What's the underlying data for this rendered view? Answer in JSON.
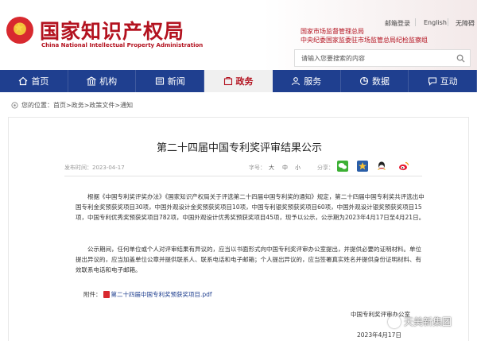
{
  "header": {
    "site_title": "国家知识产权局",
    "site_subtitle": "China National Intellectual Property Administration",
    "org_line1": "国家市场监督管理总局",
    "org_line2": "中央纪委国家监委驻市场监管总局纪检监察组",
    "links": {
      "mail": "邮箱登录",
      "english": "English",
      "accessible": "无障碍"
    },
    "search_placeholder": "请输入您要搜索的内容"
  },
  "nav": {
    "items": [
      {
        "label": "首页",
        "icon": "home-icon"
      },
      {
        "label": "机构",
        "icon": "building-icon"
      },
      {
        "label": "新闻",
        "icon": "news-icon"
      },
      {
        "label": "政务",
        "icon": "government-icon",
        "active": true
      },
      {
        "label": "服务",
        "icon": "service-icon"
      },
      {
        "label": "数据",
        "icon": "data-icon"
      },
      {
        "label": "互动",
        "icon": "interaction-icon"
      }
    ]
  },
  "breadcrumb": {
    "text": "您的位置：首页>政务>政策文件>通知"
  },
  "article": {
    "title": "第二十四届中国专利奖评审结果公示",
    "publish_time": "发布时间：2023-04-17",
    "font_label": "字号：",
    "font_big": "大",
    "font_mid": "中",
    "font_small": "小",
    "share_label": "分享：",
    "para1": "根据《中国专利奖评奖办法》《国家知识产权局关于评选第二十四届中国专利奖的通知》规定，第二十四届中国专利奖共评选出中国专利金奖预获奖项目30项，中国外观设计金奖预获奖项目10项，中国专利银奖预获奖项目60项，中国外观设计银奖预获奖项目15项，中国专利优秀奖预获奖项目782项，中国外观设计优秀奖预获奖项目45项，现予以公示，公示期为2023年4月17日至4月21日。",
    "para2": "公示期间，任何单位或个人对评审结果有异议的，应当以书面形式向中国专利奖评审办公室提出，并提供必要的证明材料。单位提出异议的，应当加盖单位公章并提供联系人、联系电话和电子邮箱；个人提出异议的，应当签署真实姓名并提供身份证明材料、有效联系电话和电子邮箱。",
    "attachment_label": "附件：",
    "attachment_name": "第二十四届中国专利奖预获奖项目.pdf",
    "signature_org": "中国专利奖评审办公室",
    "signature_date": "2023年4月17日"
  },
  "watermark": {
    "text": "天美新集团"
  },
  "colors": {
    "brand_red": "#b3121f",
    "nav_blue": "#1f3f8f"
  }
}
